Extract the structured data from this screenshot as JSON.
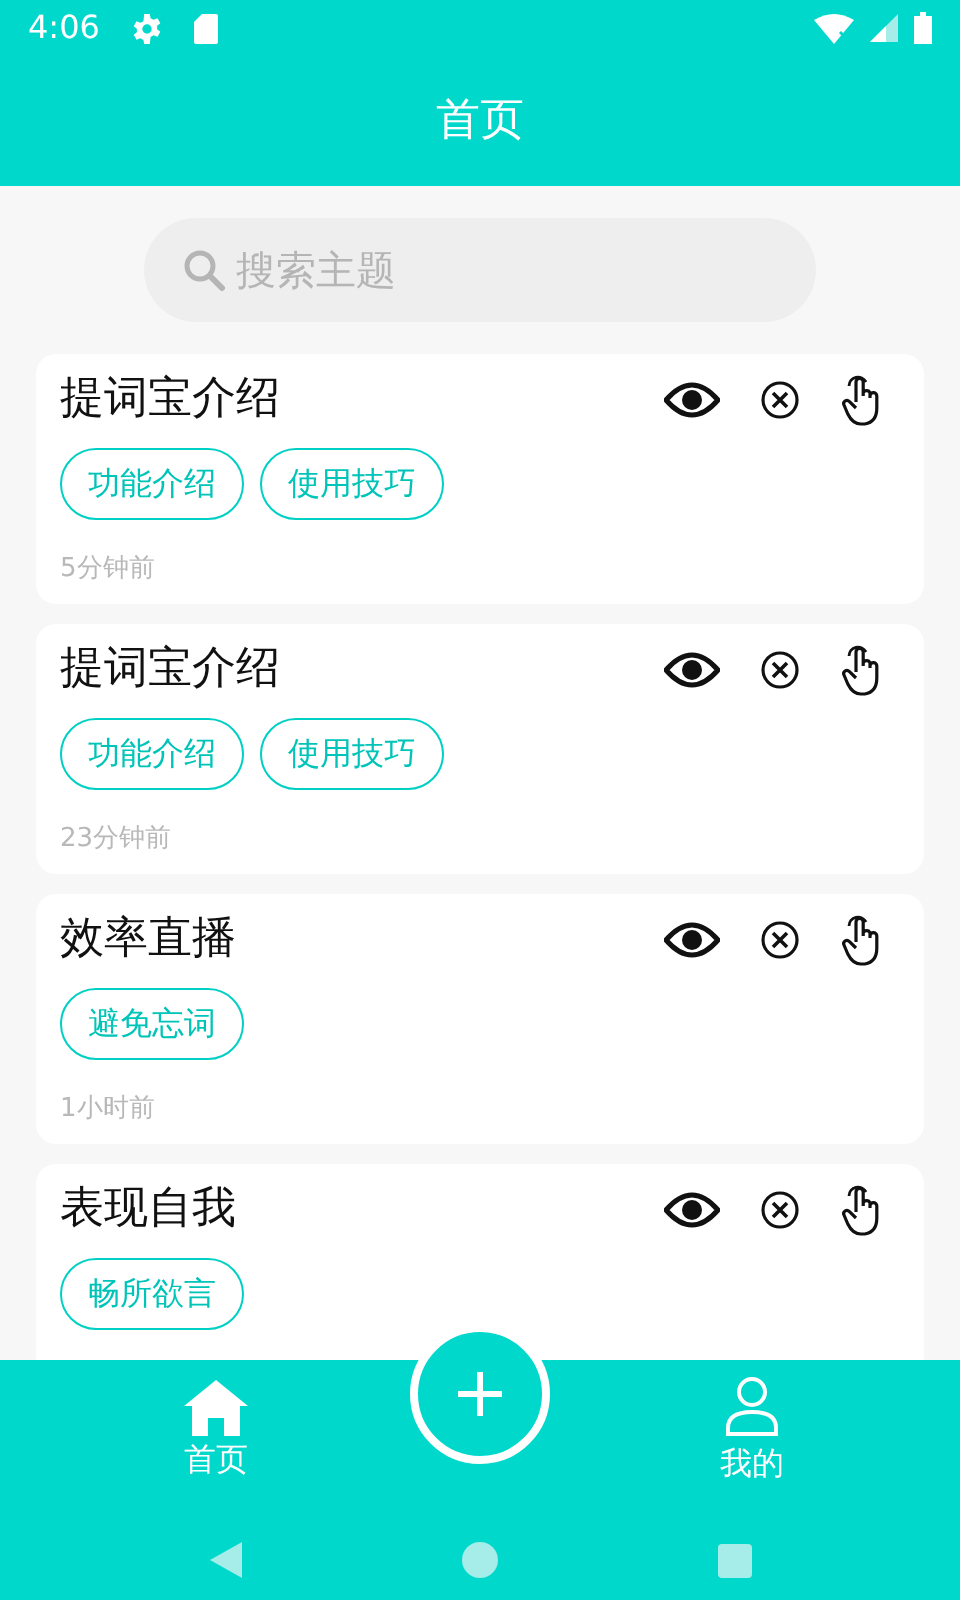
{
  "status_bar": {
    "time": "4:06"
  },
  "header": {
    "title": "首页"
  },
  "search": {
    "placeholder": "搜索主题"
  },
  "cards": [
    {
      "title": "提词宝介绍",
      "tags": [
        "功能介绍",
        "使用技巧"
      ],
      "time": "5分钟前"
    },
    {
      "title": "提词宝介绍",
      "tags": [
        "功能介绍",
        "使用技巧"
      ],
      "time": "23分钟前"
    },
    {
      "title": "效率直播",
      "tags": [
        "避免忘词"
      ],
      "time": "1小时前"
    },
    {
      "title": "表现自我",
      "tags": [
        "畅所欲言"
      ]
    }
  ],
  "bottom_nav": [
    {
      "kind": "home",
      "label": "首页"
    },
    {
      "kind": "profile",
      "label": "我的"
    }
  ]
}
